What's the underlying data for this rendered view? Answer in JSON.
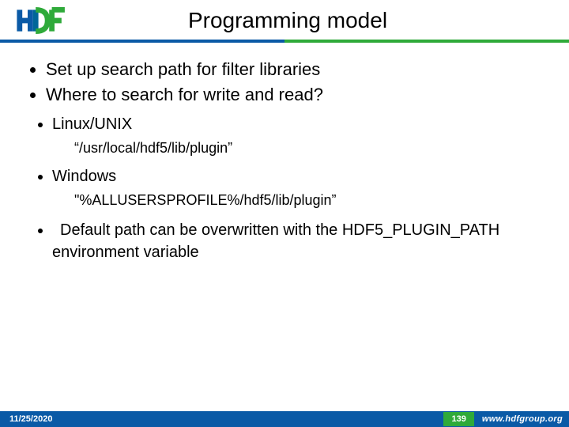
{
  "header": {
    "title": "Programming model",
    "logo_alt": "HDF"
  },
  "bullets": {
    "b1": "Set up search path for filter libraries",
    "b2": "Where to search for write and read?",
    "os1": "Linux/UNIX",
    "path1": "“/usr/local/hdf5/lib/plugin”",
    "os2": "Windows",
    "path2": "\"%ALLUSERSPROFILE%/hdf5/lib/plugin”",
    "note": "Default path can be overwritten with the HDF5_PLUGIN_PATH environment variable"
  },
  "footer": {
    "date": "11/25/2020",
    "page": "139",
    "url": "www.hdfgroup.org"
  }
}
